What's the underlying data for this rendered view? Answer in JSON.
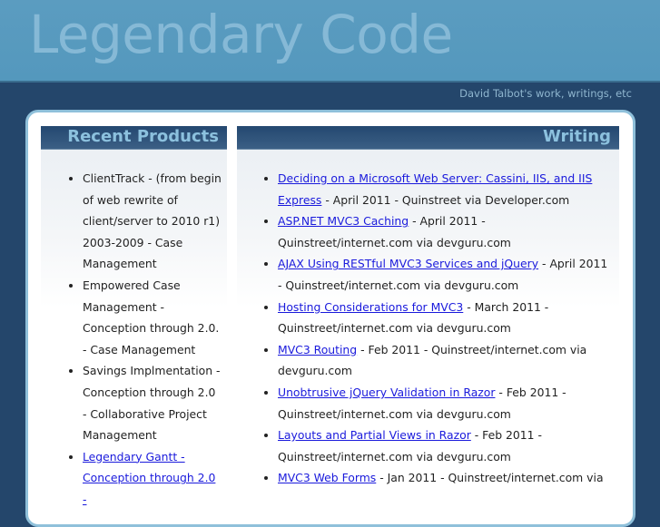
{
  "header": {
    "title": "Legendary Code",
    "tagline": "David Talbot's work, writings, etc"
  },
  "products": {
    "heading": "Recent Products",
    "items": [
      {
        "text": "ClientTrack - (from begin of web rewrite of client/server to 2010 r1) 2003-2009 - Case Management"
      },
      {
        "text": "Empowered Case Management - Conception through 2.0. - Case Management"
      },
      {
        "text": "Savings Implmentation - Conception through 2.0 - Collaborative Project Management"
      },
      {
        "link": "Legendary Gantt - Conception through 2.0 -"
      }
    ]
  },
  "writing": {
    "heading": "Writing",
    "items": [
      {
        "link": "Deciding on a Microsoft Web Server: Cassini, IIS, and IIS Express",
        "text": " - April 2011 - Quinstreet via Developer.com"
      },
      {
        "link": "ASP.NET MVC3 Caching",
        "text": " - April 2011 - Quinstreet/internet.com via devguru.com"
      },
      {
        "link": "AJAX Using RESTful MVC3 Services and jQuery",
        "text": " - April 2011 - Quinstreet/internet.com via devguru.com"
      },
      {
        "link": "Hosting Considerations for MVC3",
        "text": " - March 2011 - Quinstreet/internet.com via devguru.com"
      },
      {
        "link": "MVC3 Routing",
        "text": " - Feb 2011 - Quinstreet/internet.com via devguru.com"
      },
      {
        "link": "Unobtrusive jQuery Validation in Razor",
        "text": " - Feb 2011 - Quinstreet/internet.com via devguru.com"
      },
      {
        "link": "Layouts and Partial Views in Razor",
        "text": " - Feb 2011 - Quinstreet/internet.com via devguru.com"
      },
      {
        "link": "MVC3 Web Forms",
        "text": " - Jan 2011 - Quinstreet/internet.com via"
      }
    ]
  }
}
